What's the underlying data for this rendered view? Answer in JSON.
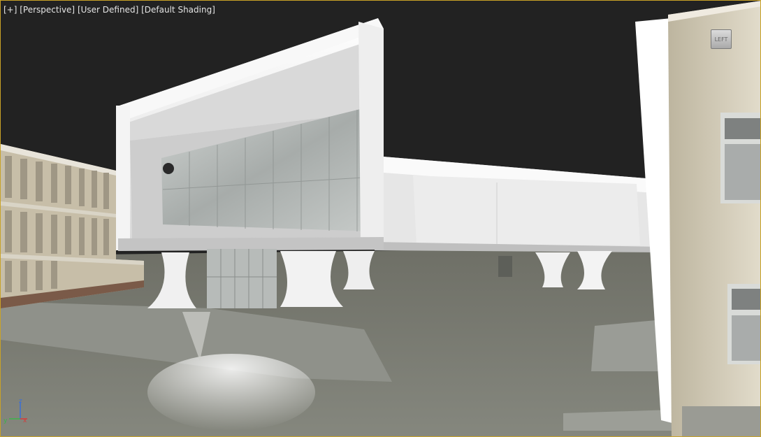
{
  "viewport": {
    "plus_menu": "[+]",
    "view_menu": "[Perspective]",
    "preset_menu": "[User Defined]",
    "shading_menu": "[Default Shading]"
  },
  "viewcube": {
    "face_label": "LEFT",
    "icon": "viewcube-icon"
  },
  "axis_tripod": {
    "x_label": "x",
    "y_label": "y",
    "z_label": "z",
    "icon": "axis-tripod-icon"
  },
  "colors": {
    "background": "#222222",
    "viewport_border": "#c9a227",
    "ground": "#7b7d72",
    "building_facade": "#dedad0",
    "glass": "#b9bdbb"
  }
}
